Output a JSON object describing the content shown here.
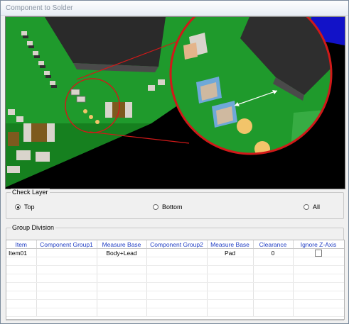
{
  "window": {
    "title": "Component to Solder"
  },
  "check_layer": {
    "title": "Check Layer",
    "options": [
      {
        "label": "Top",
        "selected": true
      },
      {
        "label": "Bottom",
        "selected": false
      },
      {
        "label": "All",
        "selected": false
      }
    ]
  },
  "group_division": {
    "title": "Group Division",
    "columns": [
      "Item",
      "Component Group1",
      "Measure Base",
      "Component Group2",
      "Measure Base",
      "Clearance",
      "Ignore Z-Axis"
    ],
    "rows": [
      {
        "item": "Item01",
        "group1": "",
        "base1": "Body+Lead",
        "group2": "",
        "base2": "Pad",
        "clearance": "0",
        "ignore_z": false
      }
    ]
  },
  "colors": {
    "header_text": "#1f3dc4",
    "pcb_green": "#1f9a2c",
    "callout": "#d01919"
  }
}
